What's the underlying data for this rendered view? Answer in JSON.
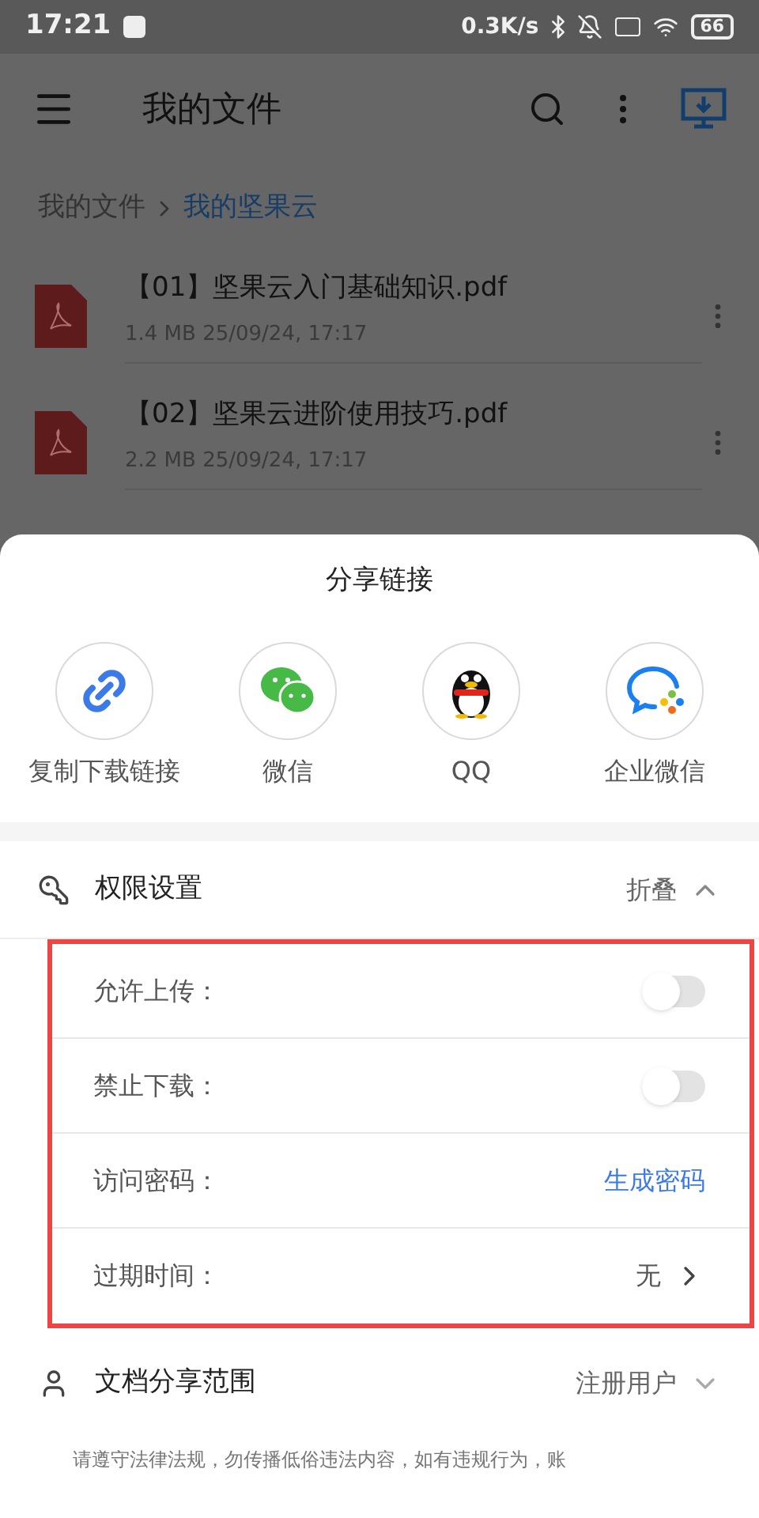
{
  "status_bar": {
    "time": "17:21",
    "network_speed": "0.3K/s",
    "battery": "66"
  },
  "app_bar": {
    "title": "我的文件"
  },
  "breadcrumb": [
    {
      "label": "我的文件",
      "selected": false
    },
    {
      "label": "我的坚果云",
      "selected": true
    }
  ],
  "files": [
    {
      "name": "【01】坚果云入门基础知识.pdf",
      "meta": "1.4 MB 25/09/24, 17:17"
    },
    {
      "name": "【02】坚果云进阶使用技巧.pdf",
      "meta": "2.2 MB 25/09/24, 17:17"
    }
  ],
  "share_sheet": {
    "title": "分享链接",
    "targets": [
      {
        "label": "复制下载链接",
        "kind": "link"
      },
      {
        "label": "微信",
        "kind": "wechat"
      },
      {
        "label": "QQ",
        "kind": "qq"
      },
      {
        "label": "企业微信",
        "kind": "wecom"
      }
    ]
  },
  "permissions": {
    "title": "权限设置",
    "toggle_label": "折叠",
    "expanded": true,
    "rows": [
      {
        "kind": "toggle",
        "label": "允许上传：",
        "on": false
      },
      {
        "kind": "toggle",
        "label": "禁止下载：",
        "on": false
      },
      {
        "kind": "link",
        "label": "访问密码：",
        "value": "生成密码"
      },
      {
        "kind": "select",
        "label": "过期时间：",
        "value": "无"
      }
    ]
  },
  "scope": {
    "title": "文档分享范围",
    "value": "注册用户",
    "expanded": false
  },
  "notice": "请遵守法律法规，勿传播低俗违法内容，如有违规行为，账"
}
